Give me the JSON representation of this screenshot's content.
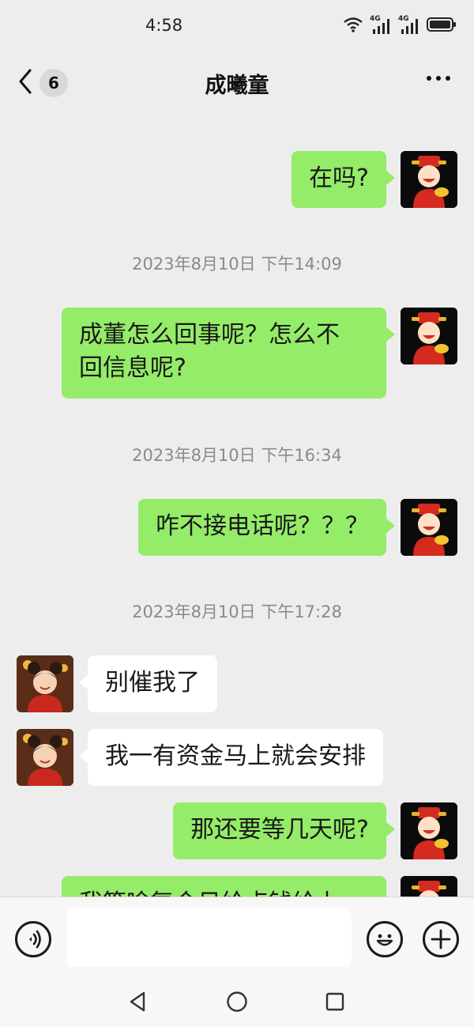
{
  "status_bar": {
    "time": "4:58",
    "network_label_1": "4G",
    "network_label_2": "4G"
  },
  "nav": {
    "unread_count": "6",
    "title": "成曦童"
  },
  "messages": [
    {
      "type": "message",
      "side": "self",
      "lines": [
        "在吗?"
      ]
    },
    {
      "type": "timestamp",
      "text": "2023年8月10日 下午14:09"
    },
    {
      "type": "message",
      "side": "self",
      "lines": [
        "成董怎么回事呢？怎么不",
        "回信息呢?"
      ]
    },
    {
      "type": "timestamp",
      "text": "2023年8月10日 下午16:34"
    },
    {
      "type": "message",
      "side": "self",
      "lines": [
        "咋不接电话呢？？？"
      ]
    },
    {
      "type": "timestamp",
      "text": "2023年8月10日 下午17:28"
    },
    {
      "type": "message",
      "side": "other",
      "lines": [
        "别催我了"
      ]
    },
    {
      "type": "message",
      "side": "other",
      "lines": [
        "我一有资金马上就会安排"
      ]
    },
    {
      "type": "message",
      "side": "self",
      "lines": [
        "那还要等几天呢?"
      ]
    },
    {
      "type": "message",
      "side": "self",
      "lines": [
        "我等啥复合日给点钱给上"
      ]
    }
  ],
  "input_bar": {
    "voice_icon": "voice-icon",
    "emoji_icon": "emoji-icon",
    "plus_icon": "plus-icon",
    "input_value": ""
  },
  "system_nav": {
    "icons": [
      "back-triangle-icon",
      "home-circle-icon",
      "recents-square-icon"
    ]
  },
  "colors": {
    "background": "#ededed",
    "self_bubble": "#95ec69",
    "other_bubble": "#ffffff",
    "timestamp_text": "#8a8a8a"
  }
}
